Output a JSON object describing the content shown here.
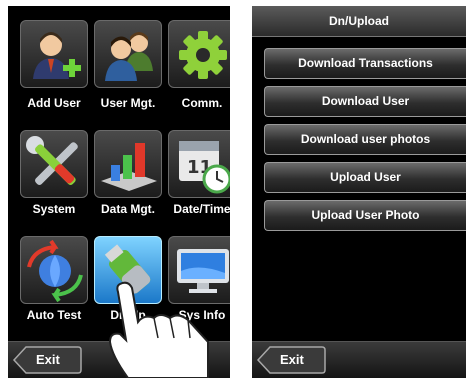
{
  "left_screen": {
    "tiles": [
      {
        "label": "Add User",
        "icon": "add-user-icon"
      },
      {
        "label": "User Mgt.",
        "icon": "users-icon"
      },
      {
        "label": "Comm.",
        "icon": "gear-icon"
      },
      {
        "label": "System",
        "icon": "tools-icon"
      },
      {
        "label": "Data Mgt.",
        "icon": "bar-chart-icon"
      },
      {
        "label": "Date/Time",
        "icon": "calendar-clock-icon"
      },
      {
        "label": "Auto Test",
        "icon": "refresh-globe-icon"
      },
      {
        "label": "Dn/Up",
        "icon": "usb-drive-icon"
      },
      {
        "label": "Sys Info",
        "icon": "monitor-icon"
      }
    ],
    "exit_label": "Exit"
  },
  "right_screen": {
    "title": "Dn/Upload",
    "menu": [
      "Download Transactions",
      "Download User",
      "Download user photos",
      "Upload User",
      "Upload User Photo"
    ],
    "exit_label": "Exit"
  },
  "colors": {
    "screen_bg": "#000000",
    "selected_tile": "#3aa6ee",
    "text": "#ffffff"
  }
}
